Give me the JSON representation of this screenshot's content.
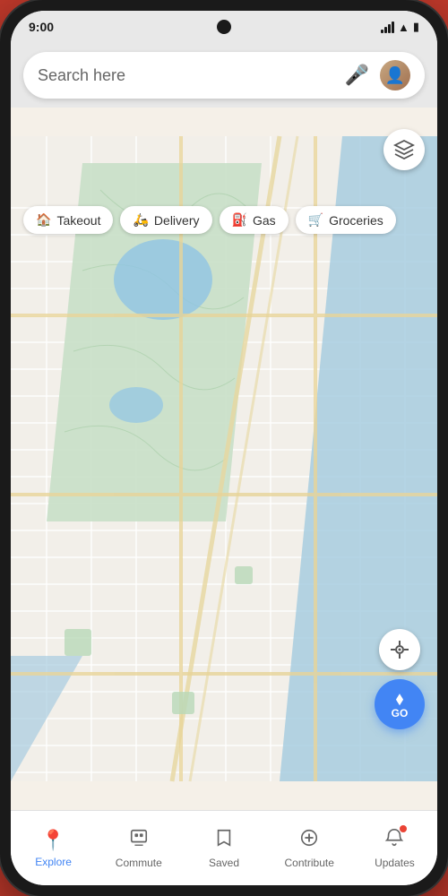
{
  "status_bar": {
    "time": "9:00"
  },
  "search": {
    "placeholder": "Search here"
  },
  "chips": [
    {
      "id": "takeout",
      "label": "Takeout",
      "icon": "🏠"
    },
    {
      "id": "delivery",
      "label": "Delivery",
      "icon": "🛵"
    },
    {
      "id": "gas",
      "label": "Gas",
      "icon": "⛽"
    },
    {
      "id": "groceries",
      "label": "Groceries",
      "icon": "🛒"
    }
  ],
  "map_controls": {
    "layers_icon": "◈",
    "location_icon": "⊕",
    "go_label": "GO"
  },
  "bottom_nav": [
    {
      "id": "explore",
      "label": "Explore",
      "icon": "📍",
      "active": true,
      "badge": false
    },
    {
      "id": "commute",
      "label": "Commute",
      "icon": "🏢",
      "active": false,
      "badge": false
    },
    {
      "id": "saved",
      "label": "Saved",
      "icon": "🔖",
      "active": false,
      "badge": false
    },
    {
      "id": "contribute",
      "label": "Contribute",
      "icon": "➕",
      "active": false,
      "badge": false
    },
    {
      "id": "updates",
      "label": "Updates",
      "icon": "🔔",
      "active": false,
      "badge": true
    }
  ]
}
